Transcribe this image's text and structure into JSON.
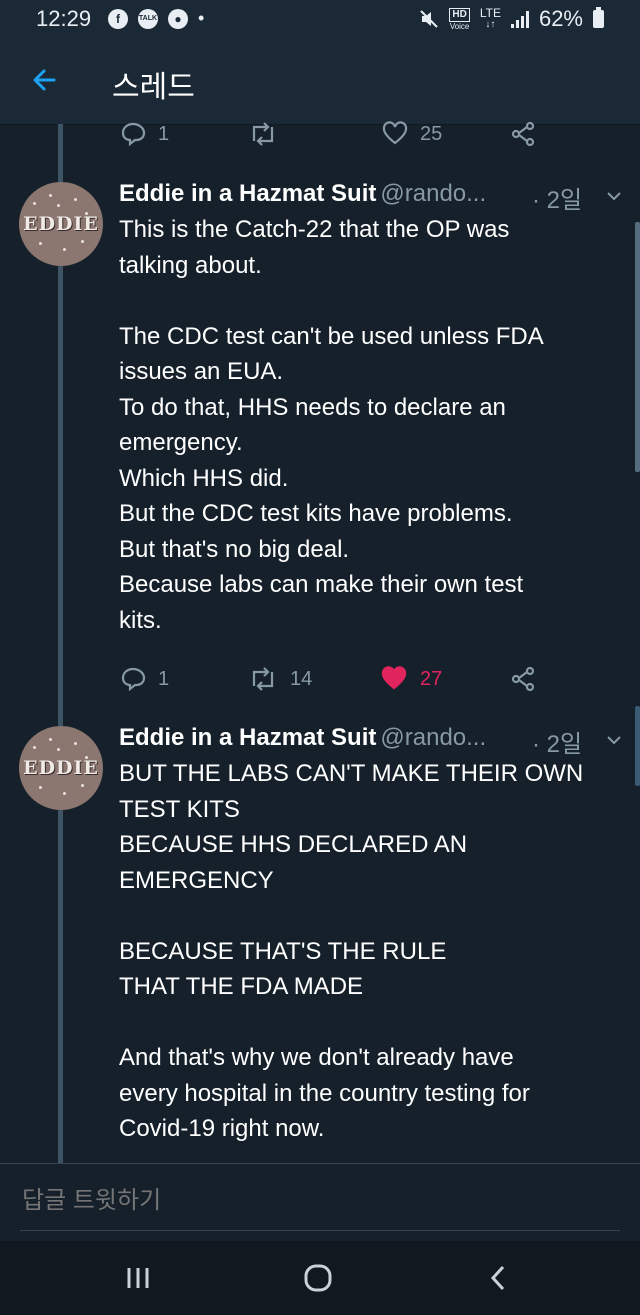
{
  "status_bar": {
    "time": "12:29",
    "notifications": [
      "facebook-icon",
      "talk-icon",
      "circle-play-icon"
    ],
    "dot": "•",
    "hd": "HD",
    "voice": "Voice",
    "lte": "LTE",
    "battery": "62%"
  },
  "header": {
    "title": "스레드"
  },
  "top_actions": {
    "reply_count": "1",
    "retweet_count": "",
    "like_count": "25"
  },
  "tweets": [
    {
      "author": "Eddie in a Hazmat Suit",
      "handle": "@rando...",
      "time": "· 2일",
      "avatar_text": "EDDIE",
      "text": "This is the Catch-22 that the OP was\ntalking about.\n\nThe CDC test can't be used unless FDA\nissues an EUA.\nTo do that, HHS needs to declare an\nemergency.\nWhich HHS did.\nBut the CDC test kits have problems.\nBut that's no big deal.\nBecause labs can make their own test\nkits.",
      "reply_count": "1",
      "retweet_count": "14",
      "like_count": "27"
    },
    {
      "author": "Eddie in a Hazmat Suit",
      "handle": "@rando...",
      "time": "· 2일",
      "avatar_text": "EDDIE",
      "text": "BUT THE LABS CAN'T MAKE THEIR OWN\nTEST KITS\nBECAUSE HHS DECLARED AN\nEMERGENCY\n\nBECAUSE THAT'S THE RULE\nTHAT THE FDA MADE\n\nAnd that's why we don't already have\nevery hospital in the country testing for\nCovid-19 right now."
    }
  ],
  "reply_bar": {
    "placeholder": "답글 트윗하기"
  },
  "colors": {
    "background": "#15202b",
    "accent": "#1da1f2",
    "muted": "#8899a6",
    "like": "#e0245e"
  }
}
